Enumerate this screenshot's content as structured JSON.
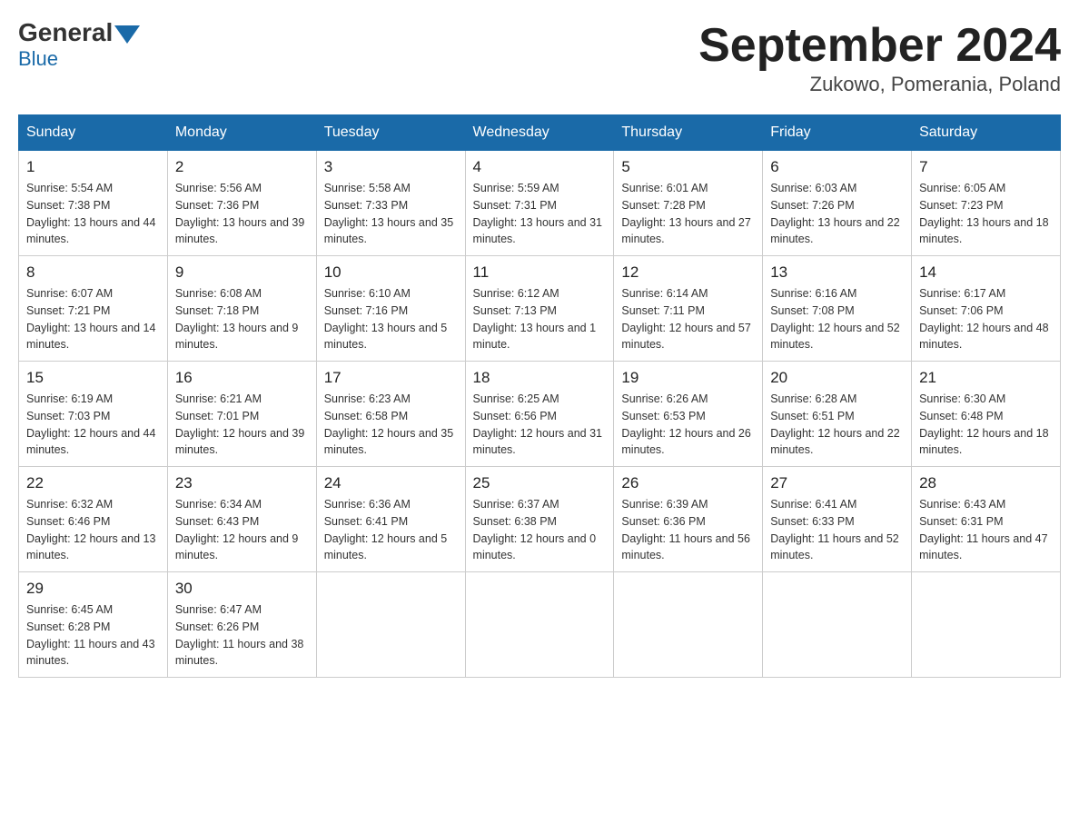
{
  "header": {
    "logo_general": "General",
    "logo_blue": "Blue",
    "title": "September 2024",
    "location": "Zukowo, Pomerania, Poland"
  },
  "days_of_week": [
    "Sunday",
    "Monday",
    "Tuesday",
    "Wednesday",
    "Thursday",
    "Friday",
    "Saturday"
  ],
  "weeks": [
    [
      {
        "day": "1",
        "sunrise": "5:54 AM",
        "sunset": "7:38 PM",
        "daylight": "13 hours and 44 minutes."
      },
      {
        "day": "2",
        "sunrise": "5:56 AM",
        "sunset": "7:36 PM",
        "daylight": "13 hours and 39 minutes."
      },
      {
        "day": "3",
        "sunrise": "5:58 AM",
        "sunset": "7:33 PM",
        "daylight": "13 hours and 35 minutes."
      },
      {
        "day": "4",
        "sunrise": "5:59 AM",
        "sunset": "7:31 PM",
        "daylight": "13 hours and 31 minutes."
      },
      {
        "day": "5",
        "sunrise": "6:01 AM",
        "sunset": "7:28 PM",
        "daylight": "13 hours and 27 minutes."
      },
      {
        "day": "6",
        "sunrise": "6:03 AM",
        "sunset": "7:26 PM",
        "daylight": "13 hours and 22 minutes."
      },
      {
        "day": "7",
        "sunrise": "6:05 AM",
        "sunset": "7:23 PM",
        "daylight": "13 hours and 18 minutes."
      }
    ],
    [
      {
        "day": "8",
        "sunrise": "6:07 AM",
        "sunset": "7:21 PM",
        "daylight": "13 hours and 14 minutes."
      },
      {
        "day": "9",
        "sunrise": "6:08 AM",
        "sunset": "7:18 PM",
        "daylight": "13 hours and 9 minutes."
      },
      {
        "day": "10",
        "sunrise": "6:10 AM",
        "sunset": "7:16 PM",
        "daylight": "13 hours and 5 minutes."
      },
      {
        "day": "11",
        "sunrise": "6:12 AM",
        "sunset": "7:13 PM",
        "daylight": "13 hours and 1 minute."
      },
      {
        "day": "12",
        "sunrise": "6:14 AM",
        "sunset": "7:11 PM",
        "daylight": "12 hours and 57 minutes."
      },
      {
        "day": "13",
        "sunrise": "6:16 AM",
        "sunset": "7:08 PM",
        "daylight": "12 hours and 52 minutes."
      },
      {
        "day": "14",
        "sunrise": "6:17 AM",
        "sunset": "7:06 PM",
        "daylight": "12 hours and 48 minutes."
      }
    ],
    [
      {
        "day": "15",
        "sunrise": "6:19 AM",
        "sunset": "7:03 PM",
        "daylight": "12 hours and 44 minutes."
      },
      {
        "day": "16",
        "sunrise": "6:21 AM",
        "sunset": "7:01 PM",
        "daylight": "12 hours and 39 minutes."
      },
      {
        "day": "17",
        "sunrise": "6:23 AM",
        "sunset": "6:58 PM",
        "daylight": "12 hours and 35 minutes."
      },
      {
        "day": "18",
        "sunrise": "6:25 AM",
        "sunset": "6:56 PM",
        "daylight": "12 hours and 31 minutes."
      },
      {
        "day": "19",
        "sunrise": "6:26 AM",
        "sunset": "6:53 PM",
        "daylight": "12 hours and 26 minutes."
      },
      {
        "day": "20",
        "sunrise": "6:28 AM",
        "sunset": "6:51 PM",
        "daylight": "12 hours and 22 minutes."
      },
      {
        "day": "21",
        "sunrise": "6:30 AM",
        "sunset": "6:48 PM",
        "daylight": "12 hours and 18 minutes."
      }
    ],
    [
      {
        "day": "22",
        "sunrise": "6:32 AM",
        "sunset": "6:46 PM",
        "daylight": "12 hours and 13 minutes."
      },
      {
        "day": "23",
        "sunrise": "6:34 AM",
        "sunset": "6:43 PM",
        "daylight": "12 hours and 9 minutes."
      },
      {
        "day": "24",
        "sunrise": "6:36 AM",
        "sunset": "6:41 PM",
        "daylight": "12 hours and 5 minutes."
      },
      {
        "day": "25",
        "sunrise": "6:37 AM",
        "sunset": "6:38 PM",
        "daylight": "12 hours and 0 minutes."
      },
      {
        "day": "26",
        "sunrise": "6:39 AM",
        "sunset": "6:36 PM",
        "daylight": "11 hours and 56 minutes."
      },
      {
        "day": "27",
        "sunrise": "6:41 AM",
        "sunset": "6:33 PM",
        "daylight": "11 hours and 52 minutes."
      },
      {
        "day": "28",
        "sunrise": "6:43 AM",
        "sunset": "6:31 PM",
        "daylight": "11 hours and 47 minutes."
      }
    ],
    [
      {
        "day": "29",
        "sunrise": "6:45 AM",
        "sunset": "6:28 PM",
        "daylight": "11 hours and 43 minutes."
      },
      {
        "day": "30",
        "sunrise": "6:47 AM",
        "sunset": "6:26 PM",
        "daylight": "11 hours and 38 minutes."
      },
      null,
      null,
      null,
      null,
      null
    ]
  ]
}
